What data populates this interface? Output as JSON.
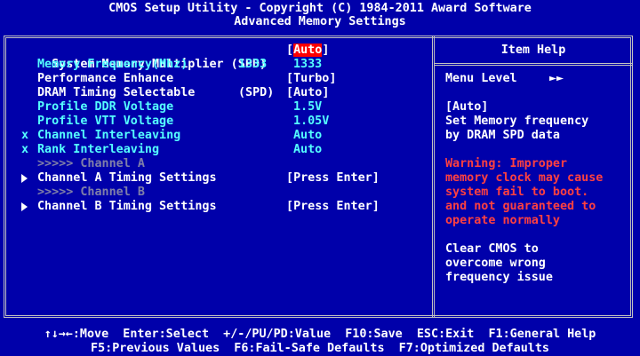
{
  "header": {
    "line1": "CMOS Setup Utility - Copyright (C) 1984-2011 Award Software",
    "line2": "Advanced Memory Settings"
  },
  "settings": [
    {
      "label": "System Memory Multiplier (SPD)",
      "value": "Auto",
      "bracket": true,
      "selected": true
    },
    {
      "label": "Memory Frequency(Mhz)",
      "extra": "1333",
      "value": "1333",
      "bracket": false
    },
    {
      "label": "Performance Enhance",
      "value": "Turbo",
      "bracket": true
    },
    {
      "label": "DRAM Timing Selectable",
      "extra": "(SPD)",
      "value": "Auto",
      "bracket": true
    },
    {
      "label": "Profile DDR Voltage",
      "value": "1.5V",
      "bracket": false
    },
    {
      "label": "Profile VTT Voltage",
      "value": "1.05V",
      "bracket": false
    },
    {
      "label": "Channel Interleaving",
      "prefix": "x",
      "value": "Auto",
      "bracket": false
    },
    {
      "label": "Rank Interleaving",
      "prefix": "x",
      "value": "Auto",
      "bracket": false
    },
    {
      "label": ">>>>> Channel A"
    },
    {
      "label": "Channel A Timing Settings",
      "value": "Press Enter",
      "bracket": true
    },
    {
      "label": ">>>>> Channel B"
    },
    {
      "label": "Channel B Timing Settings",
      "value": "Press Enter",
      "bracket": true
    }
  ],
  "help": {
    "title": "Item Help",
    "menu_level_label": "Menu Level",
    "menu_level_value": "►►",
    "lines": [
      "[Auto]",
      "Set Memory frequency",
      "by DRAM SPD data"
    ],
    "warning": [
      "Warning: Improper",
      "memory clock may cause",
      "system fail to boot.",
      "and not guaranteed to",
      "operate normally"
    ],
    "clear": [
      "Clear CMOS to",
      "overcome wrong",
      "frequency issue"
    ]
  },
  "footer": {
    "line1": "↑↓→←:Move  Enter:Select  +/-/PU/PD:Value  F10:Save  ESC:Exit  F1:General Help",
    "line2": "F5:Previous Values  F6:Fail-Safe Defaults  F7:Optimized Defaults"
  },
  "colors": {
    "background": "#0000aa",
    "text": "#ffffff",
    "cyan": "#55ffff",
    "disabled": "#8080a8",
    "warning": "#ff4040",
    "highlight": "#ff0000"
  }
}
